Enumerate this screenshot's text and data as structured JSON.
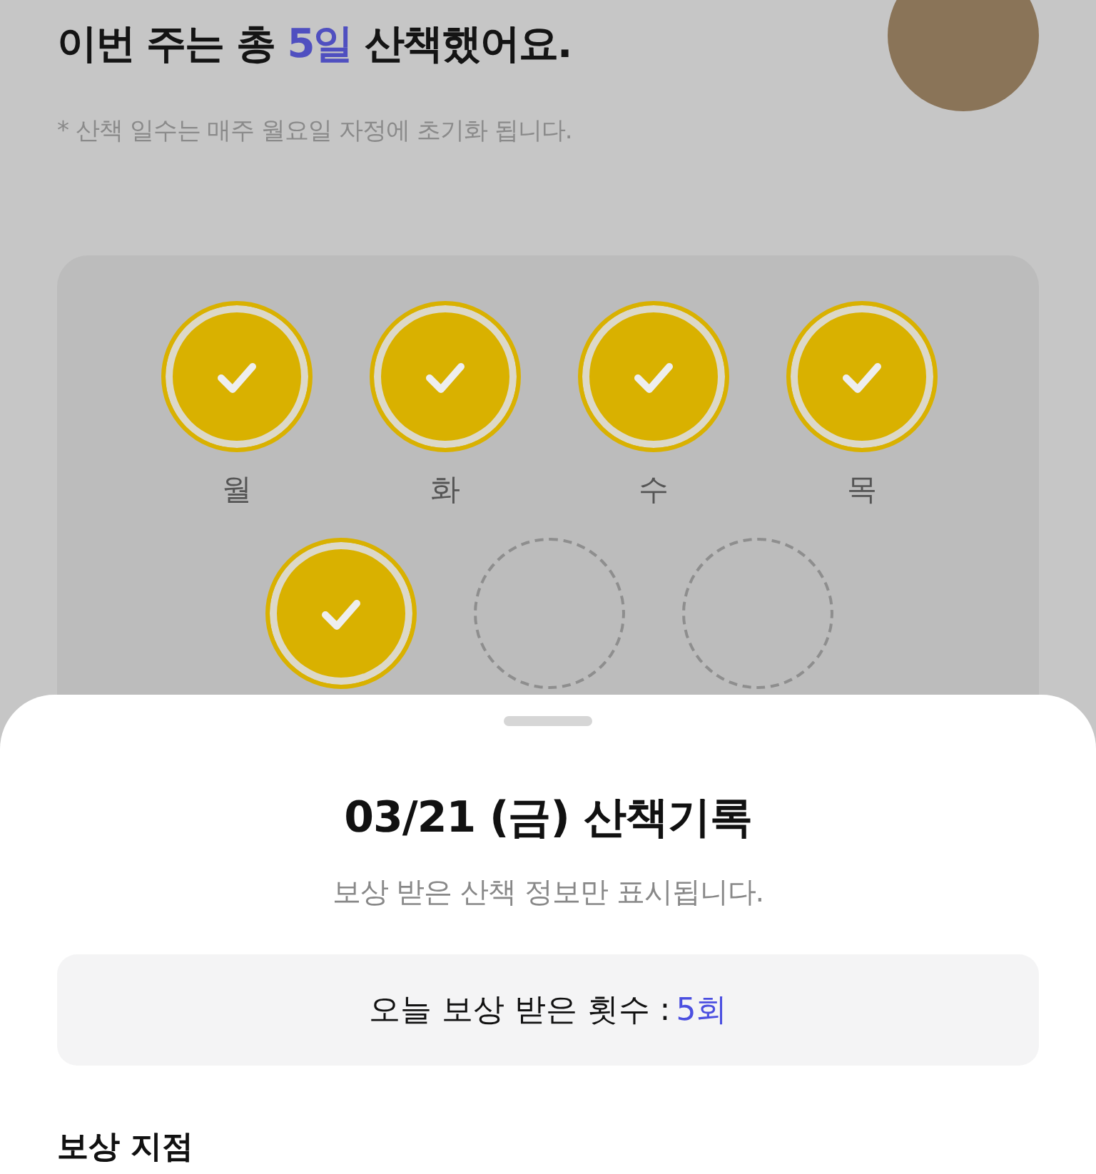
{
  "summary": {
    "headline_before": "이번 주는 총 ",
    "headline_highlight": "5일",
    "headline_after": " 산책했어요.",
    "note": "* 산책 일수는 매주 월요일 자정에 초기화 됩니다."
  },
  "days": [
    {
      "label": "월",
      "done": true
    },
    {
      "label": "화",
      "done": true
    },
    {
      "label": "수",
      "done": true
    },
    {
      "label": "목",
      "done": true
    },
    {
      "done": true
    },
    {
      "done": false
    },
    {
      "done": false
    }
  ],
  "sheet": {
    "title": "03/21 (금) 산책기록",
    "subtitle": "보상 받은 산책 정보만 표시됩니다.",
    "count_label": "오늘 보상 받은 횟수 : ",
    "count_value": "5회",
    "section_title": "보상 지점"
  }
}
